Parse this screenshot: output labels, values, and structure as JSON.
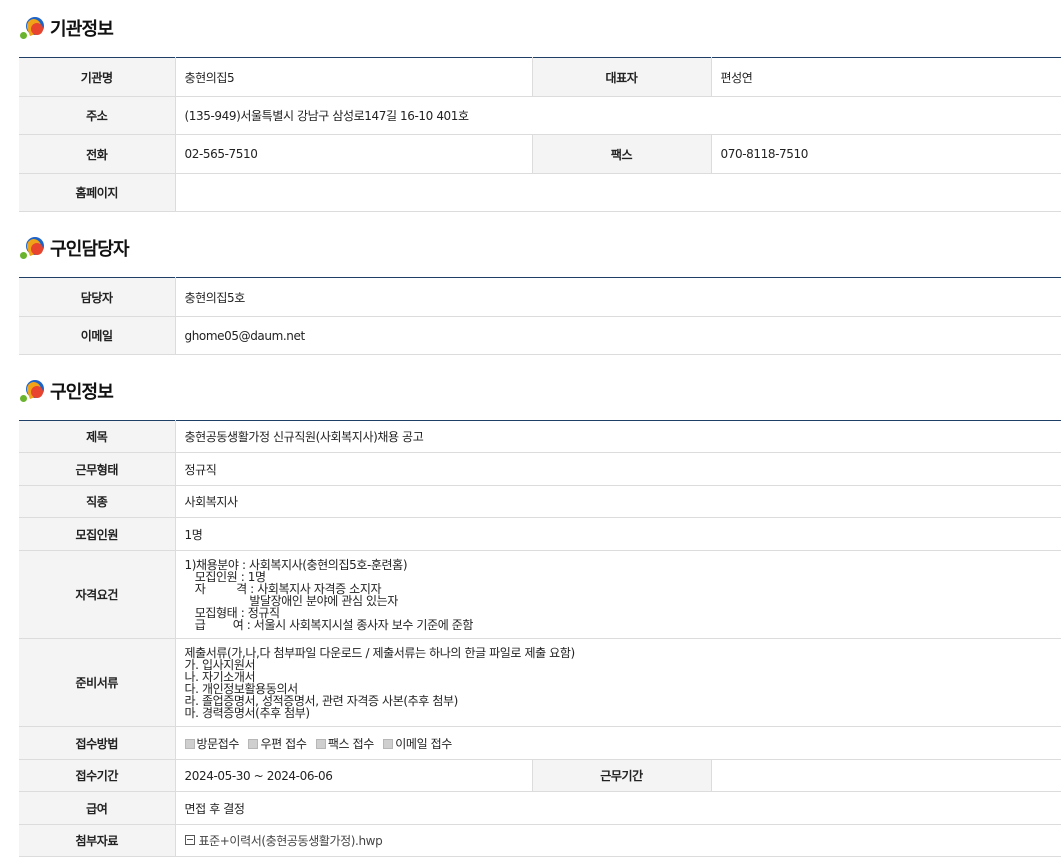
{
  "org": {
    "title": "기관정보",
    "name_label": "기관명",
    "name_value": "충현의집5",
    "rep_label": "대표자",
    "rep_value": "편성연",
    "addr_label": "주소",
    "addr_value": "(135-949)서울특별시 강남구 삼성로147길 16-10 401호",
    "tel_label": "전화",
    "tel_value": "02-565-7510",
    "fax_label": "팩스",
    "fax_value": "070-8118-7510",
    "homepage_label": "홈페이지",
    "homepage_value": ""
  },
  "contact": {
    "title": "구인담당자",
    "person_label": "담당자",
    "person_value": "충현의집5호",
    "email_label": "이메일",
    "email_value": "ghome05@daum.net"
  },
  "job": {
    "title": "구인정보",
    "subject_label": "제목",
    "subject_value": "충현공동생활가정 신규직원(사회복지사)채용 공고",
    "worktype_label": "근무형태",
    "worktype_value": "정규직",
    "occupation_label": "직종",
    "occupation_value": "사회복지사",
    "headcount_label": "모집인원",
    "headcount_value": "1명",
    "qualification_label": "자격요건",
    "qualification_value": "1)채용분야 : 사회복지사(충현의집5호-훈련홈)\n   모집인원 : 1명\n   자         격 : 사회복지사 자격증 소지자\n                   발달장애인 분야에 관심 있는자\n   모집형태 : 정규직\n   급        여 : 서울시 사회복지시설 종사자 보수 기준에 준함",
    "documents_label": "준비서류",
    "documents_value": "제출서류(가,나,다 첨부파일 다운로드 / 제출서류는 하나의 한글 파일로 제출 요함)\n가. 입사지원서\n나. 자기소개서\n다. 개인정보활용동의서\n라. 졸업증명서, 성적증명서, 관련 자격증 사본(추후 첨부)\n마. 경력증명서(추후 첨부)",
    "method_label": "접수방법",
    "methods": [
      "방문접수",
      "우편 접수",
      "팩스 접수",
      "이메일 접수"
    ],
    "period_label": "접수기간",
    "period_value": "2024-05-30 ~ 2024-06-06",
    "workperiod_label": "근무기간",
    "workperiod_value": "",
    "salary_label": "급여",
    "salary_value": "면접 후 결정",
    "attachment_label": "첨부자료",
    "attachment_value": "표준+이력서(충현공동생활가정).hwp"
  }
}
